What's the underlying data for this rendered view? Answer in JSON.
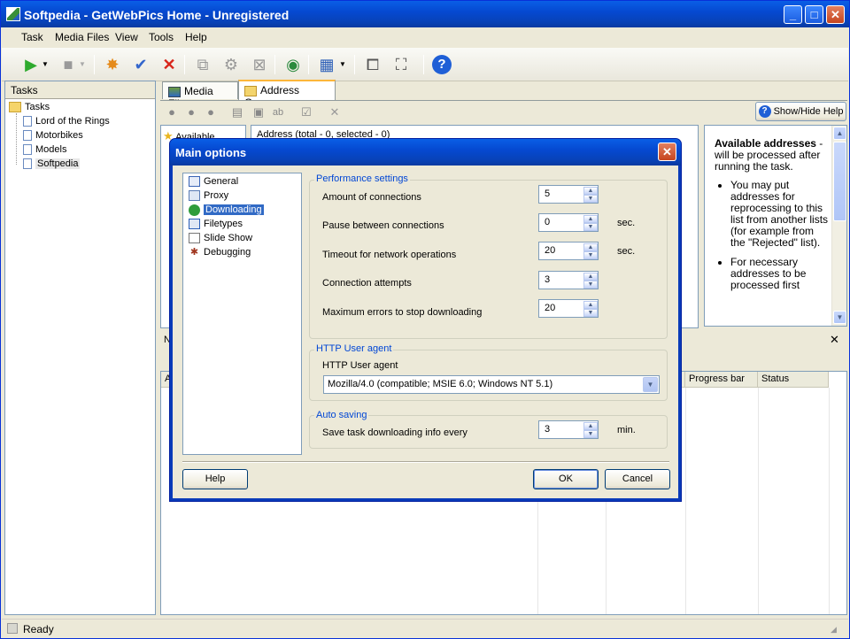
{
  "window": {
    "title": "Softpedia - GetWebPics Home - Unregistered",
    "min": "_",
    "max": "□",
    "close": "✕"
  },
  "menu": [
    "Task",
    "Media Files",
    "View",
    "Tools",
    "Help"
  ],
  "toolbar_icons": [
    "play-icon",
    "dropdown-arrow-icon",
    "stop-icon",
    "dropdown-arrow-icon",
    "new-task-icon",
    "task-properties-icon",
    "delete-icon",
    "view-icon",
    "settings-icon",
    "close-doc-icon",
    "globe-icon",
    "thumbnails-icon",
    "dropdown-arrow-icon",
    "window-icon",
    "slideshow-icon",
    "help-icon"
  ],
  "tasks": {
    "header": "Tasks",
    "root": "Tasks",
    "items": [
      "Lord of the Rings",
      "Motorbikes",
      "Models",
      "Softpedia"
    ],
    "selected": "Softpedia"
  },
  "tabs": [
    "Media Files",
    "Address Queue"
  ],
  "show_hide_help": "Show/Hide Help",
  "address_list": {
    "side_item": "Available",
    "header": "Address (total - 0, selected - 0)"
  },
  "help_text": {
    "heading": "Available addresses",
    "intro": " - will be processed after running the task.",
    "bullets": [
      "You may put addresses for reprocessing to this list from another lists (for example from the \"Rejected\" list).",
      "For necessary addresses to be processed first"
    ]
  },
  "lower": {
    "n_label": "N",
    "a_label": "A",
    "columns": [
      "Progress bar",
      "Status"
    ],
    "close": "✕"
  },
  "status_bar": "Ready",
  "dialog": {
    "title": "Main options",
    "close": "✕",
    "nav": [
      "General",
      "Proxy",
      "Downloading",
      "Filetypes",
      "Slide Show",
      "Debugging"
    ],
    "nav_selected": "Downloading",
    "performance": {
      "title": "Performance settings",
      "rows": [
        {
          "label": "Amount of connections",
          "value": "5",
          "unit": ""
        },
        {
          "label": "Pause between connections",
          "value": "0",
          "unit": "sec."
        },
        {
          "label": "Timeout for network operations",
          "value": "20",
          "unit": "sec."
        },
        {
          "label": "Connection attempts",
          "value": "3",
          "unit": ""
        },
        {
          "label": "Maximum errors to stop downloading",
          "value": "20",
          "unit": ""
        }
      ]
    },
    "http": {
      "title": "HTTP User agent",
      "label": "HTTP User agent",
      "value": "Mozilla/4.0 (compatible; MSIE 6.0; Windows NT 5.1)"
    },
    "autosave": {
      "title": "Auto saving",
      "label": "Save task downloading info every",
      "value": "3",
      "unit": "min."
    },
    "buttons": {
      "help": "Help",
      "ok": "OK",
      "cancel": "Cancel"
    }
  },
  "colors": {
    "xp_blue": "#0a5fe6",
    "group_title": "#0046d5",
    "selection": "#316ac5",
    "face": "#ece9d8"
  }
}
